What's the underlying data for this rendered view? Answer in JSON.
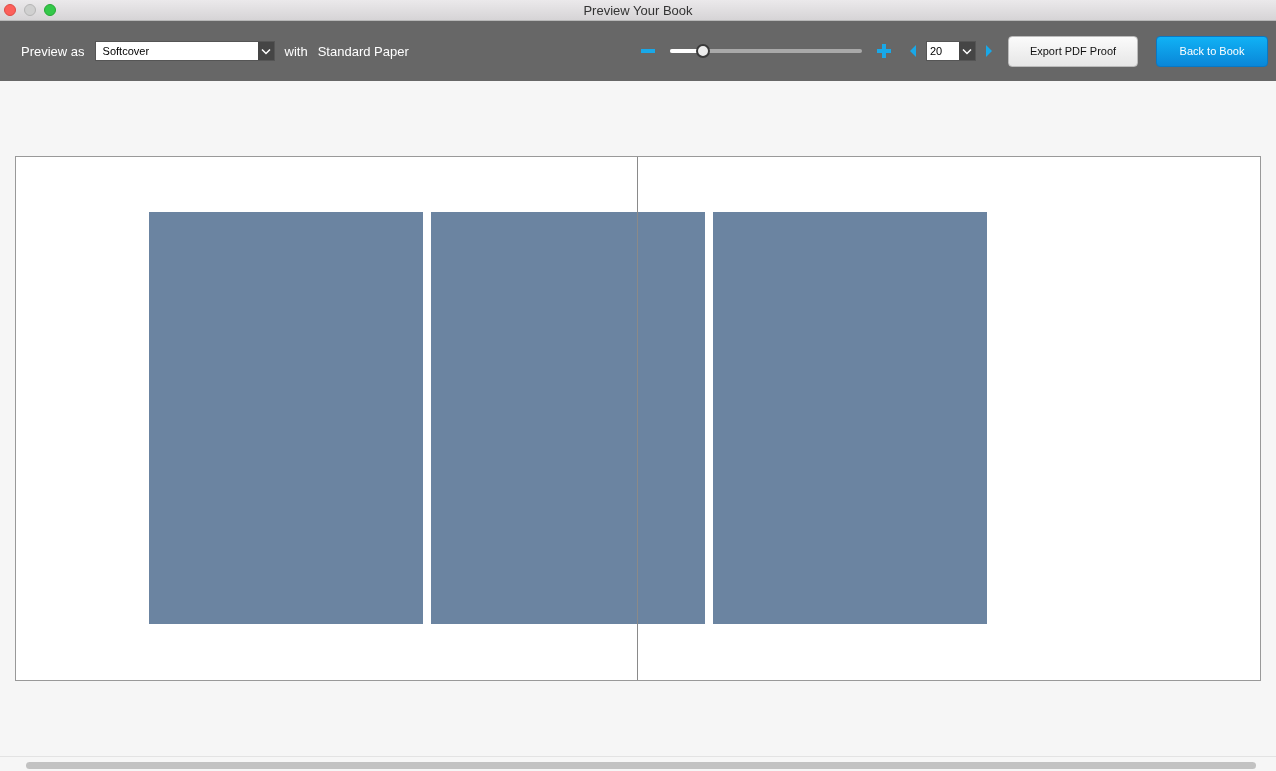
{
  "window": {
    "title": "Preview Your Book"
  },
  "toolbar": {
    "preview_label": "Preview as",
    "format": {
      "value": "Softcover"
    },
    "with_label": "with",
    "paper": "Standard Paper",
    "zoom": {
      "level": 0.17
    },
    "page": {
      "value": "20"
    },
    "buttons": [
      {
        "label": "Export PDF Proof",
        "kind": "secondary"
      },
      {
        "label": "Back to Book",
        "kind": "primary"
      }
    ]
  },
  "spread": {
    "frames": [
      {
        "kind": "placeholder"
      },
      {
        "kind": "placeholder"
      },
      {
        "kind": "placeholder"
      }
    ]
  }
}
